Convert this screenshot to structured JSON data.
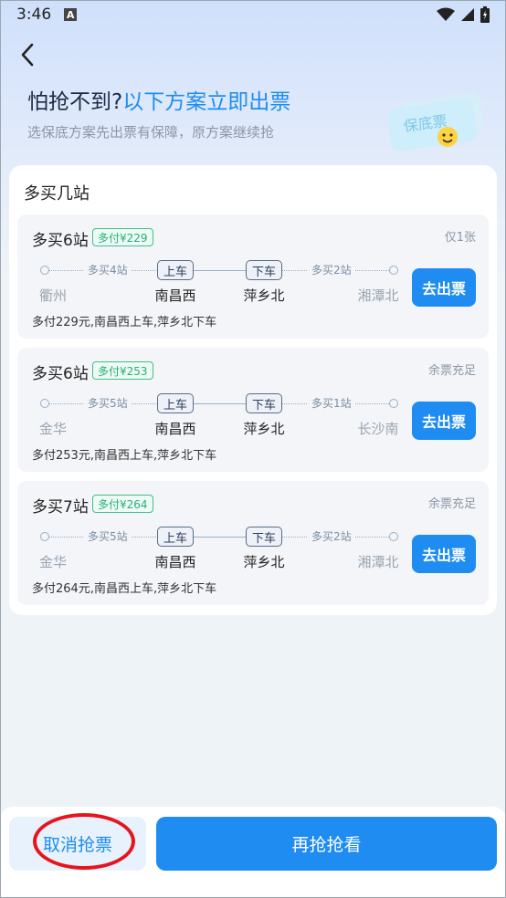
{
  "status_bar": {
    "time": "3:46",
    "notif_icon": "A"
  },
  "header": {
    "title_part1": "怕抢不到?",
    "title_part2": "以下方案立即出票",
    "subtitle": "选保底方案先出票有保障，原方案继续抢",
    "badge_text": "保底票"
  },
  "section": {
    "title": "多买几站"
  },
  "options": [
    {
      "title": "多买6站",
      "extra": "多付¥229",
      "availability": "仅1张",
      "segments": [
        "多买4站",
        "多买2站"
      ],
      "board_label": "上车",
      "alight_label": "下车",
      "stations": [
        "衢州",
        "南昌西",
        "萍乡北",
        "湘潭北"
      ],
      "desc": "多付229元,南昌西上车,萍乡北下车",
      "button": "去出票"
    },
    {
      "title": "多买6站",
      "extra": "多付¥253",
      "availability": "余票充足",
      "segments": [
        "多买5站",
        "多买1站"
      ],
      "board_label": "上车",
      "alight_label": "下车",
      "stations": [
        "金华",
        "南昌西",
        "萍乡北",
        "长沙南"
      ],
      "desc": "多付253元,南昌西上车,萍乡北下车",
      "button": "去出票"
    },
    {
      "title": "多买7站",
      "extra": "多付¥264",
      "availability": "余票充足",
      "segments": [
        "多买5站",
        "多买2站"
      ],
      "board_label": "上车",
      "alight_label": "下车",
      "stations": [
        "金华",
        "南昌西",
        "萍乡北",
        "湘潭北"
      ],
      "desc": "多付264元,南昌西上车,萍乡北下车",
      "button": "去出票"
    }
  ],
  "footer": {
    "cancel_label": "取消抢票",
    "retry_label": "再抢抢看"
  },
  "colors": {
    "accent": "#1e8cf0",
    "green_tag": "#26b07a",
    "annotation_red": "#e8141b"
  },
  "icons": [
    "back-arrow-icon",
    "wifi-icon",
    "signal-icon",
    "battery-icon"
  ]
}
